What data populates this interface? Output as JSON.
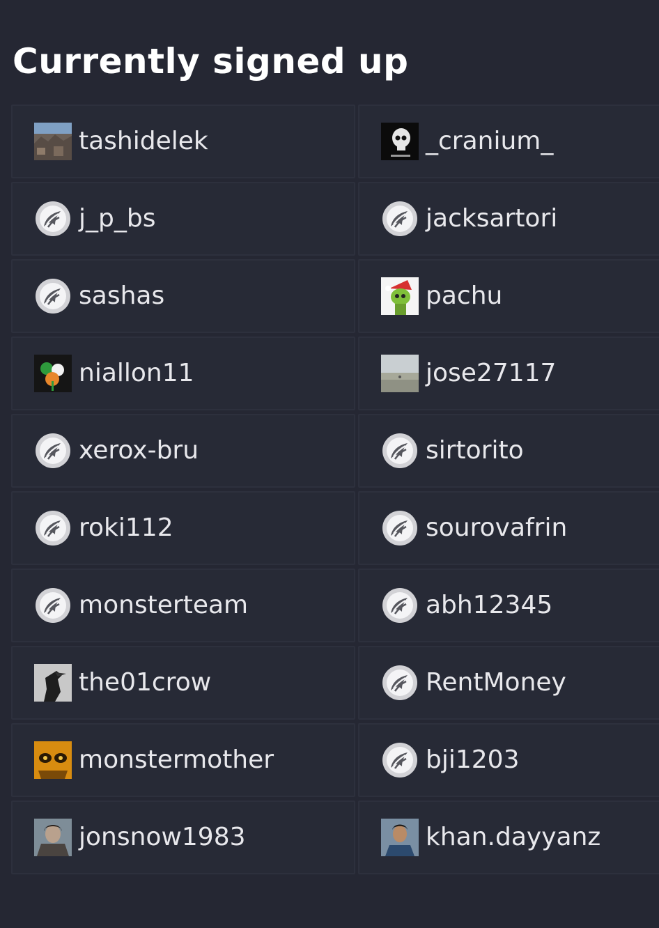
{
  "header": {
    "title": "Currently signed up"
  },
  "colors": {
    "background": "#252733",
    "card": "#272a36",
    "card_border": "#2d303d",
    "text": "#e8e8ec",
    "default_avatar": "#cfcfd3"
  },
  "users": [
    {
      "name": "tashidelek",
      "avatar": "photo-avatar-landscape-icon"
    },
    {
      "name": "_cranium_",
      "avatar": "photo-avatar-skull-icon"
    },
    {
      "name": "j_p_bs",
      "avatar": "default-avatar-icon"
    },
    {
      "name": "jacksartori",
      "avatar": "default-avatar-icon"
    },
    {
      "name": "sashas",
      "avatar": "default-avatar-icon"
    },
    {
      "name": "pachu",
      "avatar": "photo-avatar-christmas-icon"
    },
    {
      "name": "niallon11",
      "avatar": "photo-avatar-shamrock-icon"
    },
    {
      "name": "jose27117",
      "avatar": "photo-avatar-beach-icon"
    },
    {
      "name": "xerox-bru",
      "avatar": "default-avatar-icon"
    },
    {
      "name": "sirtorito",
      "avatar": "default-avatar-icon"
    },
    {
      "name": "roki112",
      "avatar": "default-avatar-icon"
    },
    {
      "name": "sourovafrin",
      "avatar": "default-avatar-icon"
    },
    {
      "name": "monsterteam",
      "avatar": "default-avatar-icon"
    },
    {
      "name": "abh12345",
      "avatar": "default-avatar-icon"
    },
    {
      "name": "the01crow",
      "avatar": "photo-avatar-crow-icon"
    },
    {
      "name": "RentMoney",
      "avatar": "default-avatar-icon"
    },
    {
      "name": "monstermother",
      "avatar": "photo-avatar-monster-icon"
    },
    {
      "name": "bji1203",
      "avatar": "default-avatar-icon"
    },
    {
      "name": "jonsnow1983",
      "avatar": "photo-avatar-jonsnow-icon"
    },
    {
      "name": "khan.dayyanz",
      "avatar": "photo-avatar-person-icon"
    }
  ]
}
